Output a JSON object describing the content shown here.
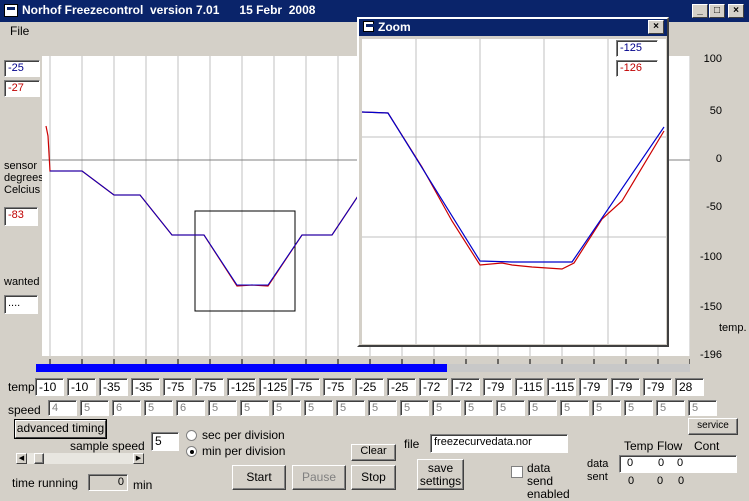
{
  "window": {
    "title": "Norhof Freezecontrol  version 7.01      15 Febr  2008",
    "min": "_",
    "max": "□",
    "close": "×"
  },
  "menu": {
    "file": "File"
  },
  "readouts": {
    "top_blue": "-25",
    "top_red": "-27",
    "sensor_label": "sensor degrees Celcius",
    "sensor_value": "-83",
    "wanted_label": "wanted",
    "wanted_value": "...."
  },
  "y_axis": {
    "ticks": [
      "100",
      "50",
      "0",
      "-50",
      "-100",
      "-150",
      "-196"
    ],
    "unit_label": "temp."
  },
  "zoom": {
    "title": "Zoom",
    "close": "×",
    "value_blue": "-125",
    "value_red": "-126"
  },
  "temp_row": {
    "label": "temp",
    "values": [
      "-10",
      "-10",
      "-35",
      "-35",
      "-75",
      "-75",
      "-125",
      "-125",
      "-75",
      "-75",
      "-25",
      "-25",
      "-72",
      "-72",
      "-79",
      "-115",
      "-115",
      "-79",
      "-79",
      "-79",
      "28"
    ]
  },
  "speed_row": {
    "label": "speed",
    "values": [
      "4",
      "5",
      "6",
      "5",
      "6",
      "5",
      "5",
      "5",
      "5",
      "5",
      "5",
      "5",
      "5",
      "5",
      "5",
      "5",
      "5",
      "5",
      "5",
      "5",
      "5"
    ]
  },
  "controls": {
    "advanced_timing": "advanced timing",
    "service": "service",
    "sample_speed_label": "sample speed",
    "sample_speed_value": "5",
    "radio_sec": "sec per division",
    "radio_min": "min per division",
    "clear": "Clear",
    "start": "Start",
    "pause": "Pause",
    "stop": "Stop",
    "save_settings": "save settings",
    "file_label": "file",
    "file_value": "freezecurvedata.nor",
    "data_send_enabled": "data send enabled",
    "time_running_label": "time running",
    "time_running_value": "0",
    "time_unit": "min"
  },
  "data_sent": {
    "label": "data sent",
    "headers": [
      "Temp",
      "Flow",
      "Cont"
    ],
    "field_values": [
      "0",
      "0",
      "0"
    ],
    "row_values": [
      "0",
      "0",
      "0"
    ]
  },
  "colors": {
    "series_blue": "#0000cc",
    "series_red": "#cc0000",
    "progress": "#0000ff",
    "titlebar": "#0a246a"
  },
  "progress": {
    "fraction": 0.63
  }
}
